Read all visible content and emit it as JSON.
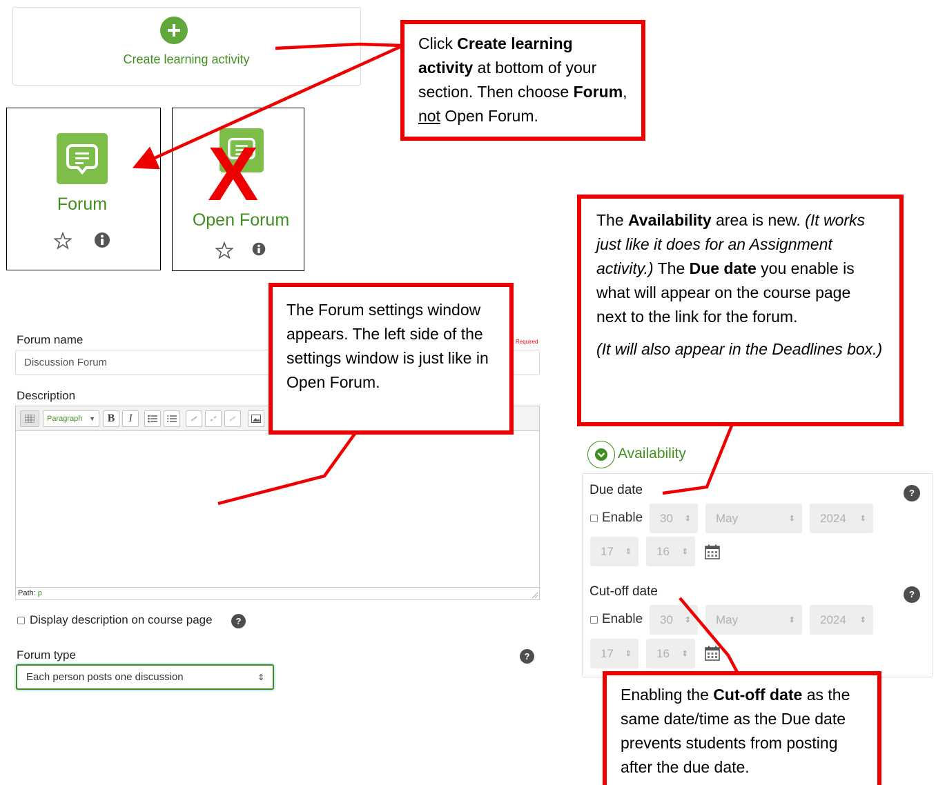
{
  "create_activity": {
    "label": "Create learning activity",
    "icon": "plus-circle-icon",
    "color": "#60a83c"
  },
  "activity_tiles": [
    {
      "label": "Forum",
      "icon": "forum-icon",
      "actions": [
        "star-icon",
        "info-icon"
      ]
    },
    {
      "label": "Open Forum",
      "icon": "forum-icon",
      "actions": [
        "star-icon",
        "info-icon"
      ],
      "crossed_out_mark": "X"
    }
  ],
  "callouts": {
    "top": {
      "t1": "Click ",
      "b1": "Create learning activity",
      "t2": " at bottom of your section. Then choose ",
      "b2": "Forum",
      "t3": ", ",
      "u1": "not",
      "t4": " Open Forum."
    },
    "middle": {
      "text": "The Forum settings window appears. The left side of the settings window is just like in Open Forum."
    },
    "availability": {
      "t1": "The ",
      "b1": "Availability",
      "t2": " area is new. ",
      "i1": "(It works just like it does for an Assignment activity.)",
      "t3": " The ",
      "b2": "Due date",
      "t4": " you enable is what will appear on the course page next to the link for the forum.",
      "i2": "(It will also appear in the Deadlines box.)"
    },
    "cutoff": {
      "t1": "Enabling the ",
      "b1": "Cut-off date",
      "t2": " as the same date/time as the Due date prevents students from posting after the due date."
    }
  },
  "form": {
    "forum_name_label": "Forum name",
    "required_text": "Required",
    "forum_name_value": "Discussion Forum",
    "description_label": "Description",
    "toolbar": {
      "paragraph_select": "Paragraph",
      "bold": "B",
      "italic": "I"
    },
    "path_label": "Path:",
    "path_value": "p",
    "display_description_label": "Display description on course page",
    "forum_type_label": "Forum type",
    "forum_type_value": "Each person posts one discussion",
    "help_glyph": "?"
  },
  "availability": {
    "section_label": "Availability",
    "due_date": {
      "label": "Due date",
      "enable_label": "Enable",
      "day": "30",
      "month": "May",
      "year": "2024",
      "hour": "17",
      "minute": "16"
    },
    "cutoff_date": {
      "label": "Cut-off date",
      "enable_label": "Enable",
      "day": "30",
      "month": "May",
      "year": "2024",
      "hour": "17",
      "minute": "16"
    },
    "help_glyph": "?",
    "arrow_glyph": "⇕"
  },
  "colors": {
    "moodle_green": "#3f8f1e",
    "icon_green": "#7dbd4a",
    "callout_red": "#ee0000"
  }
}
